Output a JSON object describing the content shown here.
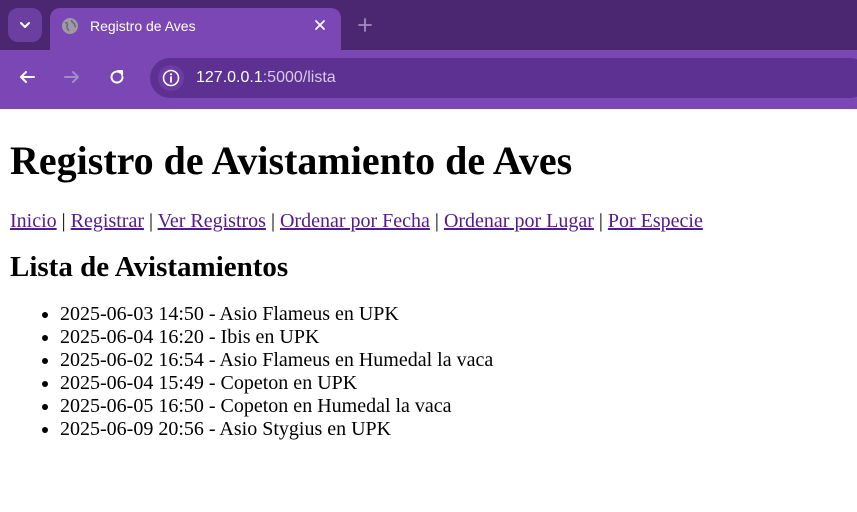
{
  "browser": {
    "tab_title": "Registro de Aves",
    "url_host": "127.0.0.1",
    "url_path": ":5000/lista",
    "tab_menu_icon": "chevron-down-icon",
    "favicon_icon": "globe-icon",
    "close_icon": "close-icon",
    "new_tab_icon": "plus-icon",
    "back_icon": "arrow-left-icon",
    "forward_icon": "arrow-right-icon",
    "reload_icon": "reload-icon",
    "site_info_icon": "info-icon",
    "colors": {
      "tabbar": "#4a2770",
      "toolbar": "#7b47b5",
      "omnibox": "#5d3192"
    }
  },
  "page": {
    "title": "Registro de Avistamiento de Aves",
    "nav": [
      {
        "label": "Inicio"
      },
      {
        "label": "Registrar"
      },
      {
        "label": "Ver Registros"
      },
      {
        "label": "Ordenar por Fecha"
      },
      {
        "label": "Ordenar por Lugar"
      },
      {
        "label": "Por Especie"
      }
    ],
    "nav_separator": "|",
    "section_title": "Lista de Avistamientos",
    "sightings": [
      "2025-06-03 14:50 - Asio Flameus en UPK",
      "2025-06-04 16:20 - Ibis en UPK",
      "2025-06-02 16:54 - Asio Flameus en Humedal la vaca",
      "2025-06-04 15:49 - Copeton en UPK",
      "2025-06-05 16:50 - Copeton en Humedal la vaca",
      "2025-06-09 20:56 - Asio Stygius en UPK"
    ],
    "link_color": "#551a8b"
  }
}
